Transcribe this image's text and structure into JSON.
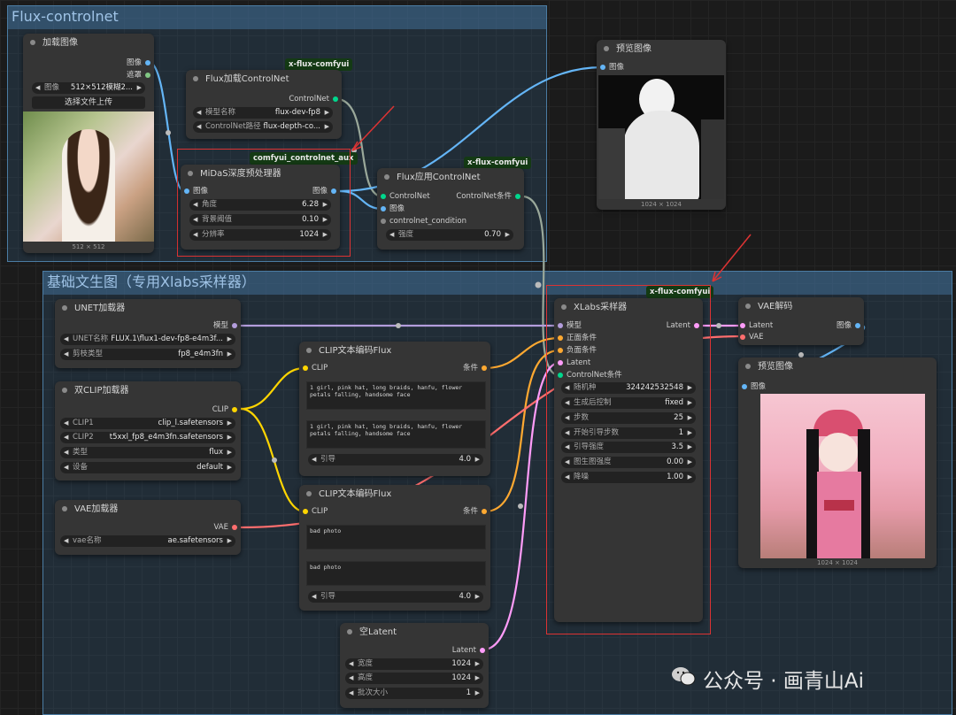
{
  "groups": {
    "flux_controlnet": "Flux-controlnet",
    "basic_t2i": "基础文生图（专用Xlabs采样器）"
  },
  "load_image": {
    "title": "加载图像",
    "out_image": "图像",
    "out_mask": "遮罩",
    "w_image_label": "图像",
    "w_image_value": "512×512模糊2...",
    "upload_button": "选择文件上传",
    "caption": "512 × 512"
  },
  "flux_load_cn": {
    "badge": "x-flux-comfyui",
    "title": "Flux加载ControlNet",
    "out": "ControlNet",
    "w_model_label": "模型名称",
    "w_model_value": "flux-dev-fp8",
    "w_path_label": "ControlNet路径",
    "w_path_value": "flux-depth-co..."
  },
  "midas": {
    "badge": "comfyui_controlnet_aux",
    "title": "MiDaS深度预处理器",
    "in_image": "图像",
    "out_image": "图像",
    "w_angle_label": "角度",
    "w_angle_value": "6.28",
    "w_bg_label": "背景阈值",
    "w_bg_value": "0.10",
    "w_res_label": "分辨率",
    "w_res_value": "1024"
  },
  "flux_apply_cn": {
    "badge": "x-flux-comfyui",
    "title": "Flux应用ControlNet",
    "in_cn": "ControlNet",
    "in_image": "图像",
    "in_cond": "controlnet_condition",
    "out": "ControlNet条件",
    "w_strength_label": "强度",
    "w_strength_value": "0.70"
  },
  "preview1": {
    "title": "预览图像",
    "in_image": "图像",
    "caption": "1024 × 1024"
  },
  "unet": {
    "title": "UNET加载器",
    "out": "模型",
    "w_name_label": "UNET名称",
    "w_name_value": "FLUX.1\\flux1-dev-fp8-e4m3f...",
    "w_dtype_label": "剪枝类型",
    "w_dtype_value": "fp8_e4m3fn"
  },
  "dual_clip": {
    "title": "双CLIP加载器",
    "out": "CLIP",
    "w_clip1_label": "CLIP1",
    "w_clip1_value": "clip_l.safetensors",
    "w_clip2_label": "CLIP2",
    "w_clip2_value": "t5xxl_fp8_e4m3fn.safetensors",
    "w_type_label": "类型",
    "w_type_value": "flux",
    "w_device_label": "设备",
    "w_device_value": "default"
  },
  "vae_loader": {
    "title": "VAE加载器",
    "out": "VAE",
    "w_name_label": "vae名称",
    "w_name_value": "ae.safetensors"
  },
  "clip_pos": {
    "title": "CLIP文本编码Flux",
    "in": "CLIP",
    "out": "条件",
    "text1": "1 girl, pink hat, long braids, hanfu, flower petals falling, handsome face",
    "text2": "1 girl, pink hat, long braids, hanfu, flower petals falling, handsome face",
    "w_guidance_label": "引导",
    "w_guidance_value": "4.0"
  },
  "clip_neg": {
    "title": "CLIP文本编码Flux",
    "in": "CLIP",
    "out": "条件",
    "text1": "bad photo",
    "text2": "bad photo",
    "w_guidance_label": "引导",
    "w_guidance_value": "4.0"
  },
  "empty_latent": {
    "title": "空Latent",
    "out": "Latent",
    "w_width_label": "宽度",
    "w_width_value": "1024",
    "w_height_label": "高度",
    "w_height_value": "1024",
    "w_batch_label": "批次大小",
    "w_batch_value": "1"
  },
  "xlabs": {
    "badge": "x-flux-comfyui",
    "title": "XLabs采样器",
    "in_model": "模型",
    "in_pos": "正面条件",
    "in_neg": "负面条件",
    "in_latent": "Latent",
    "in_cn": "ControlNet条件",
    "out": "Latent",
    "w_seed_label": "随机种",
    "w_seed_value": "324242532548",
    "w_ctrl_label": "生成后控制",
    "w_ctrl_value": "fixed",
    "w_steps_label": "步数",
    "w_steps_value": "25",
    "w_start_label": "开始引导步数",
    "w_start_value": "1",
    "w_guid_label": "引导强度",
    "w_guid_value": "3.5",
    "w_i2i_label": "图生图强度",
    "w_i2i_value": "0.00",
    "w_denoise_label": "降噪",
    "w_denoise_value": "1.00"
  },
  "vae_decode": {
    "title": "VAE解码",
    "in_latent": "Latent",
    "in_vae": "VAE",
    "out": "图像"
  },
  "preview2": {
    "title": "预览图像",
    "in_image": "图像",
    "caption": "1024 × 1024"
  },
  "watermark": "公众号 · 画青山Ai",
  "colors": {
    "image_port": "#64b5f6",
    "mask_port": "#81c784",
    "model_port": "#b39ddb",
    "clip_port": "#ffd500",
    "cond_port": "#ffa931",
    "latent_port": "#ff9cf9",
    "vae_port": "#ff6e6e",
    "cn_port": "#00d78d",
    "badge_bg": "#143a14",
    "highlight_red": "#dd3333"
  }
}
